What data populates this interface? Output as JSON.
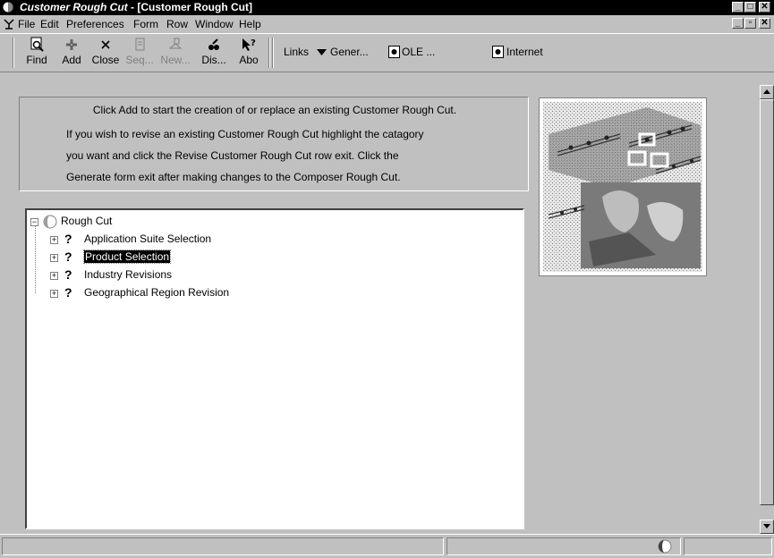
{
  "window": {
    "title_app": "Customer Rough Cut",
    "title_rest": " - [Customer Rough Cut]"
  },
  "menu": [
    "File",
    "Edit",
    "Preferences",
    "Form",
    "Row",
    "Window",
    "Help"
  ],
  "toolbar": {
    "find": "Find",
    "add": "Add",
    "close": "Close",
    "seq": "Seq...",
    "new": "New...",
    "dis": "Dis...",
    "abo": "Abo",
    "links": "Links",
    "gener": "Gener...",
    "ole": "OLE ...",
    "internet": "Internet"
  },
  "instructions": {
    "line1": "Click Add to start the creation of or replace an existing Customer Rough Cut.",
    "line2": "If you wish to revise an existing Customer Rough Cut highlight the catagory",
    "line3": "you want and click the Revise Customer Rough Cut row exit.  Click the",
    "line4": "Generate form exit after making changes to the Composer Rough Cut."
  },
  "tree": {
    "root": "Rough Cut",
    "items": [
      {
        "label": "Application Suite Selection",
        "selected": false
      },
      {
        "label": "Product Selection",
        "selected": true
      },
      {
        "label": "Industry Revisions",
        "selected": false
      },
      {
        "label": "Geographical Region Revision",
        "selected": false
      }
    ]
  },
  "colors": {
    "titlebar": "#000000",
    "face": "#c0c0c0",
    "selection": "#000000"
  },
  "icons": [
    "app-globe-icon",
    "find-icon",
    "add-icon",
    "close-icon",
    "sequence-icon",
    "new-icon",
    "display-icon",
    "about-icon",
    "dropdown-arrow-icon",
    "form-icon",
    "globe-status-icon"
  ]
}
